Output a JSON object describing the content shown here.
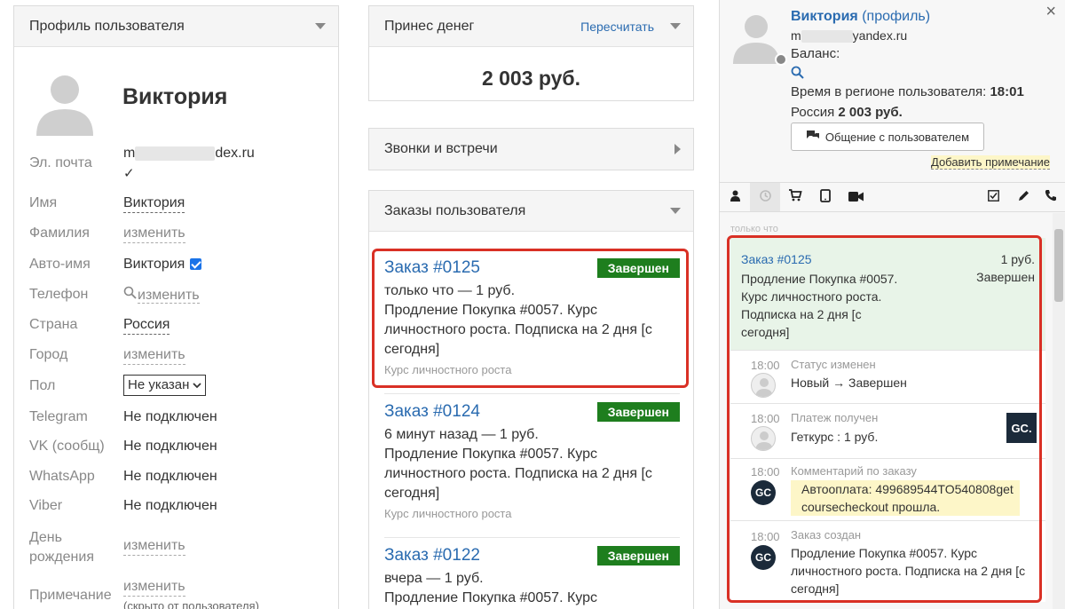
{
  "profile_panel": {
    "title": "Профиль пользователя",
    "name": "Виктория",
    "fields": [
      {
        "label": "Эл. почта",
        "value_start": "m",
        "value_end": "dex.ru"
      },
      {
        "label": "Имя",
        "value": "Виктория"
      },
      {
        "label": "Фамилия",
        "value": "изменить"
      },
      {
        "label": "Авто-имя",
        "value": "Виктория"
      },
      {
        "label": "Телефон",
        "value": "изменить"
      },
      {
        "label": "Страна",
        "value": "Россия"
      },
      {
        "label": "Город",
        "value": "изменить"
      },
      {
        "label": "Пол",
        "value": "Не указан"
      },
      {
        "label": "Telegram",
        "value": "Не подключен"
      },
      {
        "label": "VK (сообщ)",
        "value": "Не подключен"
      },
      {
        "label": "WhatsApp",
        "value": "Не подключен"
      },
      {
        "label": "Viber",
        "value": "Не подключен"
      },
      {
        "label": "День рождения",
        "value": "изменить"
      },
      {
        "label": "Примечание",
        "value": "изменить",
        "note": "(скрыто от пользователя)"
      }
    ]
  },
  "money_panel": {
    "title": "Принес денег",
    "recalc": "Пересчитать",
    "amount": "2 003 руб."
  },
  "calls_panel": {
    "title": "Звонки и встречи"
  },
  "orders_panel": {
    "title": "Заказы пользователя",
    "orders": [
      {
        "title": "Заказ #0125",
        "status": "Завершен",
        "meta": "только что — 1 руб.",
        "desc": "Продление Покупка #0057. Курс личностного роста. Подписка на 2 дня [с сегодня]",
        "course": "Курс личностного роста"
      },
      {
        "title": "Заказ #0124",
        "status": "Завершен",
        "meta": "6 минут назад — 1 руб.",
        "desc": "Продление Покупка #0057. Курс личностного роста. Подписка на 2 дня [с сегодня]",
        "course": "Курс личностного роста"
      },
      {
        "title": "Заказ #0122",
        "status": "Завершен",
        "meta": "вчера — 1 руб.",
        "desc": "Продление Покупка #0057. Курс",
        "course": ""
      }
    ]
  },
  "side_panel": {
    "name": "Виктория",
    "profile_link": "(профиль)",
    "email_start": "m",
    "email_end": "yandex.ru",
    "balance_label": "Баланс:",
    "time_label": "Время в регионе пользователя:",
    "time_value": "18:01",
    "country": "Россия",
    "amount": "2 003 руб.",
    "chat_button": "Общение с пользователем",
    "add_note": "Добавить примечание",
    "close": "×",
    "feed_time_label": "только что",
    "order_card": {
      "title": "Заказ #0125",
      "price": "1 руб.",
      "status": "Завершен",
      "desc": "Продление Покупка #0057. Курс личностного роста. Подписка на 2 дня [с сегодня]"
    },
    "events": [
      {
        "time": "18:00",
        "type": "Статус изменен",
        "text": "Новый → Завершен"
      },
      {
        "time": "18:00",
        "type": "Платеж получен",
        "text": "Геткурс : 1 руб.",
        "logo": "GC."
      },
      {
        "time": "18:00",
        "type": "Комментарий по заказу",
        "text": "Автооплата: 499689544TO540808getcoursecheckout прошла."
      },
      {
        "time": "18:00",
        "type": "Заказ создан",
        "text": "Продление Покупка #0057. Курс личностного роста. Подписка на 2 дня [с сегодня]"
      }
    ]
  },
  "icons": {
    "caret_down": "caret-down-icon",
    "caret_right": "caret-right-icon",
    "user": "user-icon",
    "history": "history-icon",
    "cart": "cart-icon",
    "tablet": "tablet-icon",
    "video": "video-icon",
    "checkbox": "checkbox-icon",
    "pencil": "pencil-icon",
    "phone": "phone-icon",
    "search": "search-icon",
    "chat": "chat-icon"
  },
  "colors": {
    "link": "#2a6bb0",
    "badge_green": "#1e7e1e",
    "highlight_red": "#d93025",
    "order_bg": "#e8f4e8",
    "note_yellow": "#fdf6c8"
  }
}
